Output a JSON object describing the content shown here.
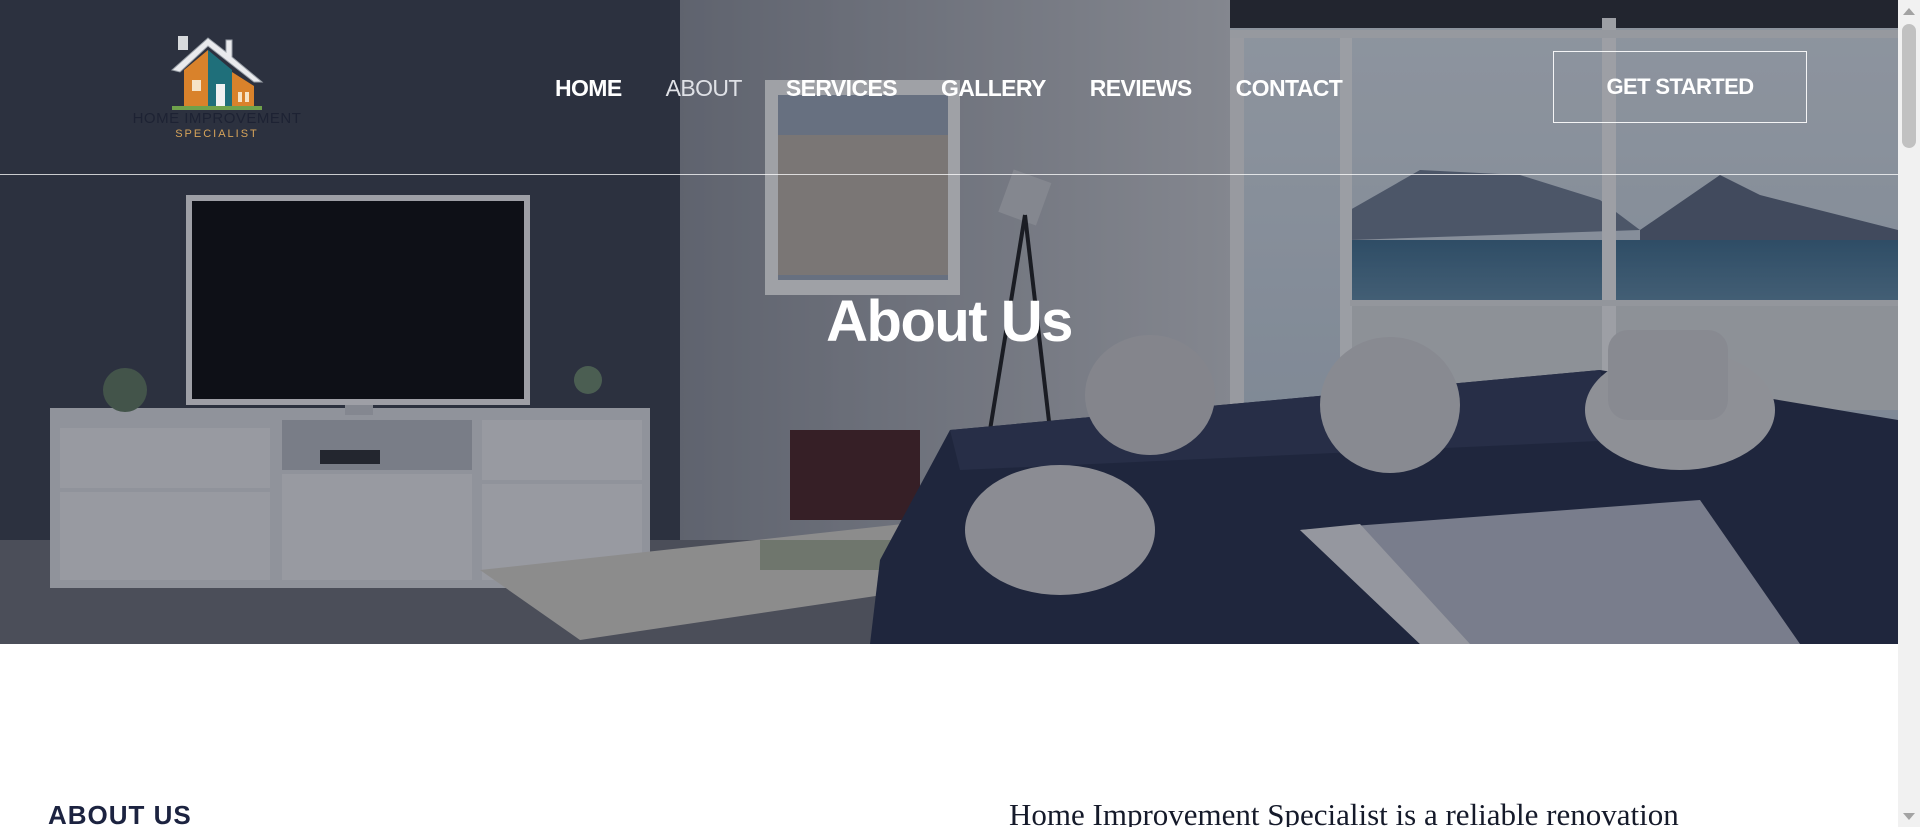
{
  "brand": {
    "name": "HOME IMPROVEMENT",
    "tagline": "SPECIALIST",
    "colors": {
      "navy": "#1d2233",
      "gold": "#d6a35a",
      "orange": "#d9822b",
      "teal": "#1f6f7a"
    }
  },
  "nav": {
    "items": [
      {
        "label": "HOME"
      },
      {
        "label": "ABOUT",
        "active": true
      },
      {
        "label": "SERVICES"
      },
      {
        "label": "GALLERY"
      },
      {
        "label": "REVIEWS"
      },
      {
        "label": "CONTACT"
      }
    ]
  },
  "header": {
    "cta_label": "GET STARTED"
  },
  "hero": {
    "title": "About Us"
  },
  "about": {
    "label": "ABOUT US",
    "intro": "Home Improvement Specialist is a reliable renovation"
  }
}
